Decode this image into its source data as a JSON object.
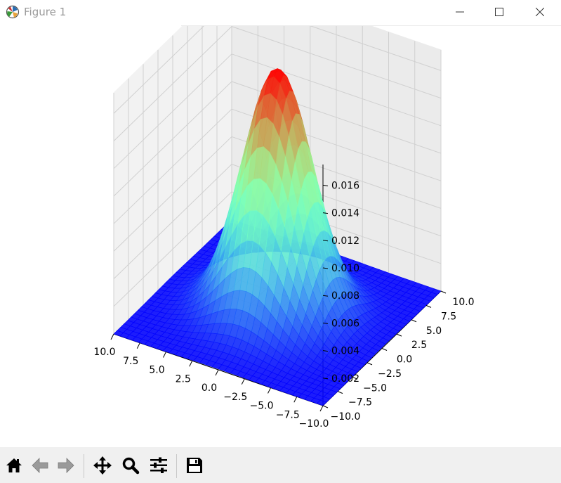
{
  "window": {
    "title": "Figure 1",
    "controls": [
      "minimize",
      "maximize",
      "close"
    ]
  },
  "toolbar": {
    "buttons": [
      {
        "name": "home",
        "icon": "home-icon"
      },
      {
        "name": "back",
        "icon": "arrow-left-icon"
      },
      {
        "name": "forward",
        "icon": "arrow-right-icon"
      },
      {
        "name": "pan",
        "icon": "move-icon"
      },
      {
        "name": "zoom",
        "icon": "magnifier-icon"
      },
      {
        "name": "configure-subplots",
        "icon": "sliders-icon"
      },
      {
        "name": "save",
        "icon": "floppy-disk-icon"
      }
    ]
  },
  "chart_data": {
    "type": "surface",
    "colormap": "rainbow",
    "function": "bivariate gaussian centered at (0,0), sigma ~3",
    "x_ticks": [
      "−10.0",
      "−7.5",
      "−5.0",
      "−2.5",
      "0.0",
      "2.5",
      "5.0",
      "7.5",
      "10.0"
    ],
    "y_ticks": [
      "−10.0",
      "−7.5",
      "−5.0",
      "−2.5",
      "0.0",
      "2.5",
      "5.0",
      "7.5",
      "10.0"
    ],
    "z_ticks": [
      "0.002",
      "0.004",
      "0.006",
      "0.008",
      "0.010",
      "0.012",
      "0.014",
      "0.016"
    ],
    "xlim": [
      -10,
      10
    ],
    "ylim": [
      -10,
      10
    ],
    "zlim": [
      0,
      0.0175
    ],
    "peak_z": 0.0177,
    "colors": {
      "low": "#8000ff",
      "high": "#ff0000"
    },
    "grid": true
  }
}
